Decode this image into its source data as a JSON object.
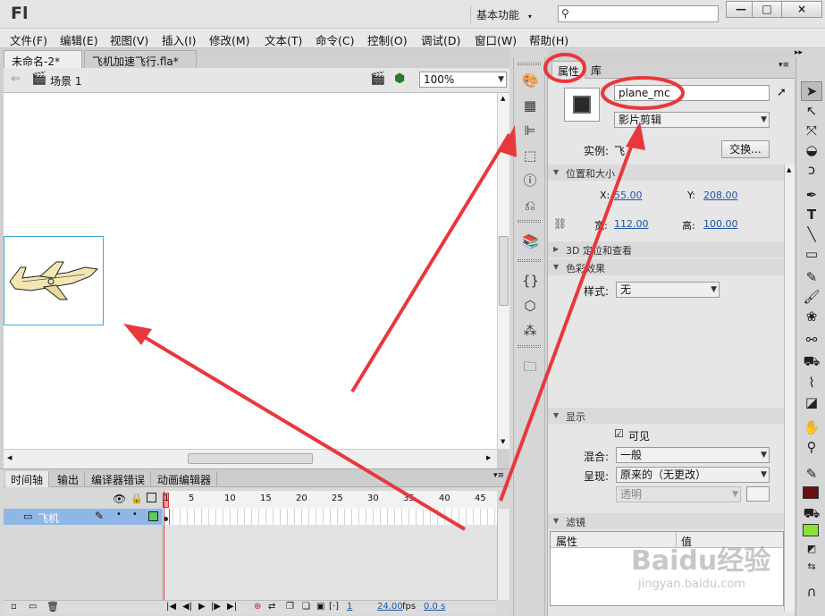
{
  "app": {
    "logo": "Fl",
    "workspace": "基本功能",
    "window_buttons": [
      "—",
      "□",
      "×"
    ]
  },
  "menu": [
    "文件(F)",
    "编辑(E)",
    "视图(V)",
    "插入(I)",
    "修改(M)",
    "文本(T)",
    "命令(C)",
    "控制(O)",
    "调试(D)",
    "窗口(W)",
    "帮助(H)"
  ],
  "doc_tabs": [
    {
      "label": "未命名-2*",
      "close": "×"
    },
    {
      "label": "飞机加速飞行.fla*",
      "close": "×"
    }
  ],
  "editbar": {
    "scene": "场景 1",
    "zoom": "100%"
  },
  "timeline": {
    "tabs": [
      "时间轴",
      "输出",
      "编译器错误",
      "动画编辑器"
    ],
    "frame_numbers": [
      "1",
      "5",
      "10",
      "15",
      "20",
      "25",
      "30",
      "35",
      "40",
      "45"
    ],
    "layer_name": "飞机",
    "footer": {
      "frame": "1",
      "fps": "24.00",
      "fps_unit": "fps",
      "time": "0.0 s"
    }
  },
  "properties": {
    "tabs": [
      "属性",
      "库"
    ],
    "instance_name": "plane_mc",
    "symbol_type": "影片剪辑",
    "instance_label": "实例:",
    "instance_of": "飞",
    "swap_button": "交换...",
    "sections": {
      "position": "位置和大小",
      "3d": "3D 定位和查看",
      "color": "色彩效果",
      "display": "显示",
      "filters": "滤镜"
    },
    "x_label": "X:",
    "x_value": "55.00",
    "y_label": "Y:",
    "y_value": "208.00",
    "w_label": "宽:",
    "w_value": "112.00",
    "h_label": "高:",
    "h_value": "100.00",
    "style_label": "样式:",
    "style_value": "无",
    "visible_label": "可见",
    "blend_label": "混合:",
    "blend_value": "一般",
    "render_label": "呈现:",
    "render_value": "原来的（无更改）",
    "transparent_value": "透明",
    "filter_col_property": "属性",
    "filter_col_value": "值"
  },
  "watermark": {
    "brand": "Baidu经验",
    "url": "jingyan.baidu.com"
  },
  "colors": {
    "annotation": "#e8383d",
    "fill_color": "#8ae234",
    "stroke_color": "#6b0f0f",
    "layer_highlight": "#8fb7e6",
    "link_blue": "#1d55a8"
  }
}
